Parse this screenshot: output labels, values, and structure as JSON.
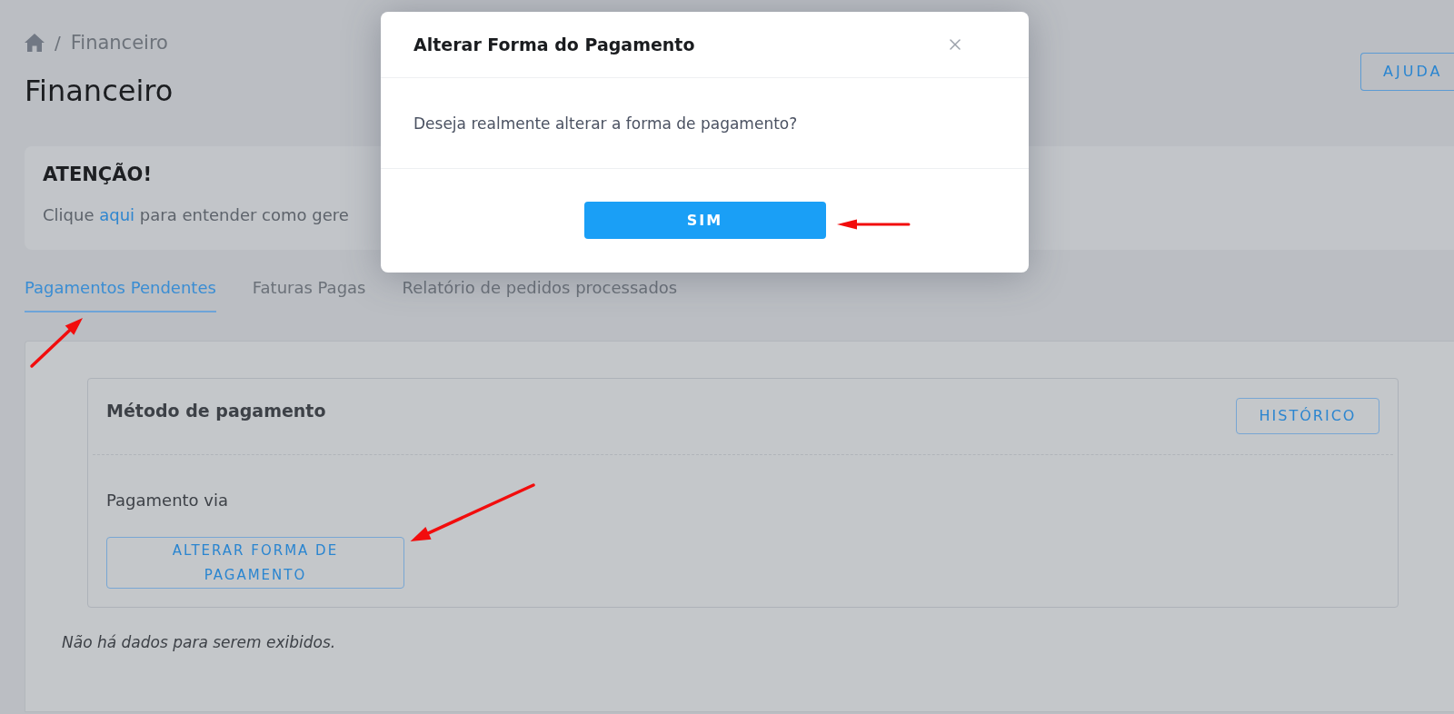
{
  "breadcrumb": {
    "separator": "/",
    "items": [
      "Financeiro"
    ]
  },
  "page_title": "Financeiro",
  "help_button": "AJUDA",
  "attention": {
    "title": "ATENÇÃO!",
    "text_before": "Clique",
    "link": "aqui",
    "text_after": "para entender como gere"
  },
  "tabs": [
    {
      "label": "Pagamentos Pendentes",
      "selected": true
    },
    {
      "label": "Faturas Pagas",
      "selected": false
    },
    {
      "label": "Relatório de pedidos processados",
      "selected": false
    }
  ],
  "payment_card": {
    "title": "Método de pagamento",
    "history_button": "HISTÓRICO",
    "label": "Pagamento via",
    "change_button": "ALTERAR FORMA DE PAGAMENTO"
  },
  "empty_message": "Não há dados para serem exibidos.",
  "modal": {
    "title": "Alterar Forma do Pagamento",
    "message": "Deseja realmente alterar a forma de pagamento?",
    "confirm_button": "SIM"
  }
}
